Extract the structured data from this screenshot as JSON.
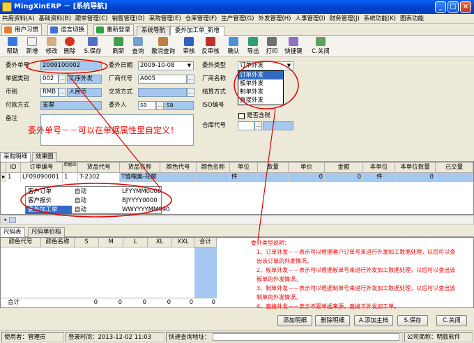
{
  "window": {
    "title": "MingXinERP － [系统导航]",
    "buttons": [
      "_",
      "□",
      "×"
    ]
  },
  "menu": [
    "共用资料(A)",
    "基础资料(B)",
    "跟单管理(C)",
    "销售管理(D)",
    "采购管理(E)",
    "仓库管理(F)",
    "生产管理(G)",
    "外发管理(H)",
    "人事管理(I)",
    "财务管理(J)",
    "系统功能(K)",
    "图表功能"
  ],
  "tabs": {
    "user_habit": "用户习惯",
    "lang_switch": "语言切换",
    "relogin": "重新登录",
    "sys_nav": "系统导航",
    "outsourcing": "委外加工单_新增"
  },
  "toolbar": [
    "帮助",
    "新增",
    "修改",
    "删除",
    "S.保存",
    "刷新",
    "查询",
    "撤消查询",
    "审核",
    "反审核",
    "确认",
    "导出",
    "打印",
    "快捷键",
    "C.关闭"
  ],
  "form": {
    "order_no_label": "委外单号",
    "order_no": "2009100002",
    "date_label": "委外日期",
    "date": "2009-10-08",
    "type_label": "委外类型",
    "type": "订单外发",
    "doc_type_label": "单据类别",
    "doc_type_code": "002",
    "doc_type_name": "工序外发",
    "vendor_code_label": "厂商代号",
    "vendor_code": "A005",
    "vendor_name_label": "厂商名称",
    "currency_label": "币别",
    "currency_code": "RMB",
    "currency_name": "人民币",
    "trade_label": "交货方式",
    "settle_label": "结算方式",
    "pay_label": "付款方式",
    "pay": "支票",
    "delegate_label": "委外人",
    "delegate_code": "sa",
    "delegate_name": "sa",
    "iso_label": "ISO编号",
    "tax_label": "是否含税",
    "note_label": "备注",
    "wh_label": "仓库代号",
    "dropdown": [
      "订单外发",
      "板单外发",
      "制单外发",
      "直接外发"
    ]
  },
  "annotation1": "委外单号－－可以在单据属性里自定义！",
  "detail_tabs": [
    "采购明细",
    "效果图"
  ],
  "grid": {
    "headers": [
      "ID",
      "订单编号",
      "单据ID",
      "货品代号",
      "货品名称",
      "颜色代号",
      "颜色名称",
      "单位",
      "数量",
      "单价",
      "金额",
      "本单位",
      "本单位数量",
      "己交量"
    ],
    "row": [
      "1",
      "LF09090001",
      "1",
      "T-2302",
      "T恤嘿美-花邮",
      "",
      "",
      "件",
      "",
      "0",
      "0",
      "件",
      "0",
      ""
    ]
  },
  "popup": [
    [
      "客户订单",
      "自动",
      "LFYYMM0000"
    ],
    [
      "客户报价",
      "自动",
      "BJYYYY0000"
    ],
    [
      "委外加工单",
      "自动",
      "WWYYYYMM990"
    ]
  ],
  "size_tabs": [
    "尺码表",
    "尺码单价档"
  ],
  "size_grid": {
    "headers": [
      "颜色代号",
      "颜色名称",
      "S",
      "M",
      "L",
      "XL",
      "XXL",
      "合计"
    ],
    "total_label": "合计",
    "totals": [
      "0",
      "0",
      "0",
      "0",
      "0",
      "0"
    ]
  },
  "annotation2": {
    "title": "委外类型说明：",
    "items": [
      "1、订单外发－－表示可以根据客户订单号来进行外发加工数据处理，以后可以查出该订单的外发情况。",
      "2、板单外发－－表示可以根据板单号来进行外发加工数据处理，以后可以查出该板单的外发情况。",
      "3、制单外发－－表示可以根据制单号来进行外发加工数据处理，以后可以查出该制单的外发情况。",
      "4、直接外发－－表示不跟单据来源，直接下外发加工单。"
    ]
  },
  "bottom_buttons": [
    "添加明细",
    "删除明细",
    "A.添加主档",
    "S.保存",
    "C.关闭"
  ],
  "status": {
    "user_label": "使用者：",
    "user": "管理员",
    "login_label": "登录时间：",
    "login": "2013-12-02 11:03",
    "query_label": "快速查询地址：",
    "company_label": "公司简称：",
    "company": "明款软件"
  }
}
